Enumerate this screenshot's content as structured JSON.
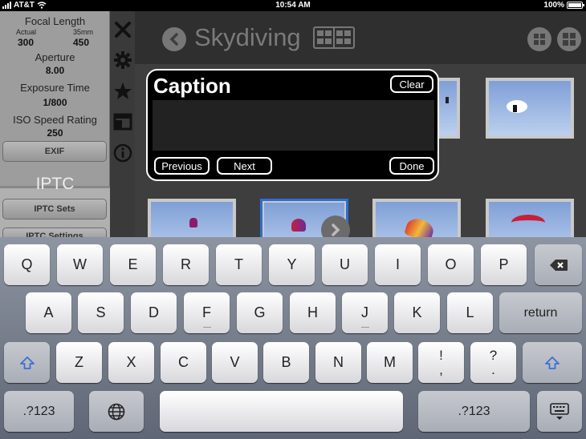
{
  "status_bar": {
    "carrier": "AT&T",
    "time": "10:54 AM",
    "battery": "100%"
  },
  "metadata_panel": {
    "focal_length_label": "Focal Length",
    "actual_label": "Actual",
    "actual_value": "300",
    "mm35_label": "35mm",
    "mm35_value": "450",
    "aperture_label": "Aperture",
    "aperture_value": "8.00",
    "exposure_label": "Exposure Time",
    "exposure_value": "1/800",
    "iso_label": "ISO Speed Rating",
    "iso_value": "250",
    "exif_button": "EXIF",
    "iptc_title": "IPTC",
    "iptc_sets_button": "IPTC Sets",
    "iptc_settings_button": "IPTC Settings"
  },
  "tools": [
    "close-icon",
    "gear-icon",
    "star-icon",
    "layout-icon",
    "info-icon"
  ],
  "album": {
    "title": "Skydiving"
  },
  "caption_popup": {
    "title": "Caption",
    "clear": "Clear",
    "previous": "Previous",
    "next": "Next",
    "done": "Done"
  },
  "keyboard": {
    "row1": [
      "Q",
      "W",
      "E",
      "R",
      "T",
      "Y",
      "U",
      "I",
      "O",
      "P"
    ],
    "row2": [
      "A",
      "S",
      "D",
      "F",
      "G",
      "H",
      "J",
      "K",
      "L"
    ],
    "return": "return",
    "row3": [
      "Z",
      "X",
      "C",
      "V",
      "B",
      "N",
      "M"
    ],
    "punct1": [
      "!",
      ","
    ],
    "punct2": [
      "?",
      "."
    ],
    "numbers": ".?123"
  },
  "colors": {
    "accent": "#2a6fd6",
    "shift": "#3b6fd8"
  }
}
